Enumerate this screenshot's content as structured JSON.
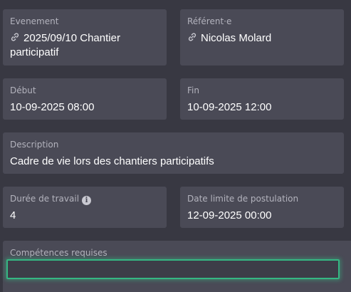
{
  "event": {
    "label": "Evenement",
    "value_line1": "2025/09/10 Chantier",
    "value_line2": "participatif"
  },
  "referent": {
    "label": "Référent·e",
    "value": "Nicolas Molard"
  },
  "start": {
    "label": "Début",
    "value": "10-09-2025 08:00"
  },
  "end": {
    "label": "Fin",
    "value": "10-09-2025 12:00"
  },
  "description": {
    "label": "Description",
    "value": "Cadre de vie lors des chantiers participatifs"
  },
  "work_duration": {
    "label": "Durée de travail",
    "value": "4",
    "info_icon": "info-icon"
  },
  "application_deadline": {
    "label": "Date limite de postulation",
    "value": "12-09-2025 00:00"
  },
  "skills": {
    "label": "Compétences requises",
    "value": ""
  },
  "colors": {
    "background": "#383842",
    "card": "#4a4a56",
    "focus_accent": "#35b783"
  }
}
